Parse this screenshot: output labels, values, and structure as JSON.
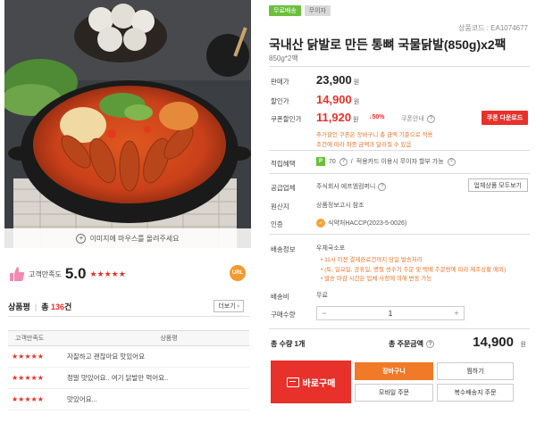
{
  "photo": {
    "caption": "이미지에 마우스를 올려주세요"
  },
  "rating": {
    "label": "고객만족도",
    "score": "5.0",
    "stars": "★★★★★",
    "badge": "URL"
  },
  "reviews": {
    "tab": "상품평",
    "total_prefix": "총",
    "total_count": "136",
    "total_suffix": "건",
    "more_label": "더보기",
    "col_rating": "고객만족도",
    "col_review": "상품평",
    "rows": [
      {
        "stars": "★★★★★",
        "text": "자잘하고 괜찮아요 맛있어요"
      },
      {
        "stars": "★★★★★",
        "text": "정말 맛있어요.. 여기 닭발만 먹어요.."
      },
      {
        "stars": "★★★★★",
        "text": "맛있어요..."
      }
    ]
  },
  "product": {
    "badge_1": "무료배송",
    "badge_2": "무이자",
    "code": "상품코드 : EA1074677",
    "title": "국내산 닭발로 만든 통뼈 국물닭발(850g)x2팩",
    "subtitle": "850g*2팩"
  },
  "price": {
    "orig_label": "판매가",
    "orig_value": "23,900",
    "sale_label": "할인가",
    "sale_value": "14,900",
    "coupon_label": "쿠폰할인가",
    "coupon_value": "11,920",
    "coupon_rate": "↓50%",
    "coupon_note": "쿠폰안내",
    "coupon_button": "쿠폰 다운로드",
    "unit": "원",
    "coupon_desc_1": "추가할인 쿠폰은 장바구니 총 금액 기준으로 적용",
    "coupon_desc_2": "조건에 따라 최종 금액과 달라질 수 있음"
  },
  "benefits": {
    "label": "적립혜택",
    "points": "70",
    "points_note": "적용카드 이용시 무이자 할부 가능"
  },
  "supplier": {
    "label": "공급업체",
    "name": "주식회사 에프엠컴퍼니",
    "button": "업체상품 모두보기"
  },
  "origin": {
    "label": "원산지",
    "value": "상품정보고시 참조"
  },
  "cert": {
    "label": "인증",
    "value": "식약처HACCP(2023-5-0026)"
  },
  "shipping": {
    "label": "배송정보",
    "method": "우체국소포",
    "note_1": "• 11시 이전 결제완료건까지 당일 발송처리",
    "note_2": "• (토, 일요일, 공휴일, 명절 성수기 주문 및 택배 주문량에 따라 제조상황 예외)",
    "note_3": "• 발송 마감 시간은 업체 사정에 의해 변동 가능",
    "fee_label": "배송비",
    "fee_value": "무료"
  },
  "quantity": {
    "label": "구매수량",
    "value": "1",
    "minus": "−",
    "plus": "+"
  },
  "total": {
    "count_text": "총 수량 1개",
    "label": "총 주문금액",
    "amount": "14,900",
    "unit": "원"
  },
  "actions": {
    "buy": "바로구매",
    "cart": "장바구니",
    "wish": "찜하기",
    "mobile": "모바일 주문",
    "multi": "복수배송지 주문"
  },
  "colors": {
    "accent": "#e8312a",
    "orange": "#f07a27",
    "green": "#6cbf3d"
  }
}
